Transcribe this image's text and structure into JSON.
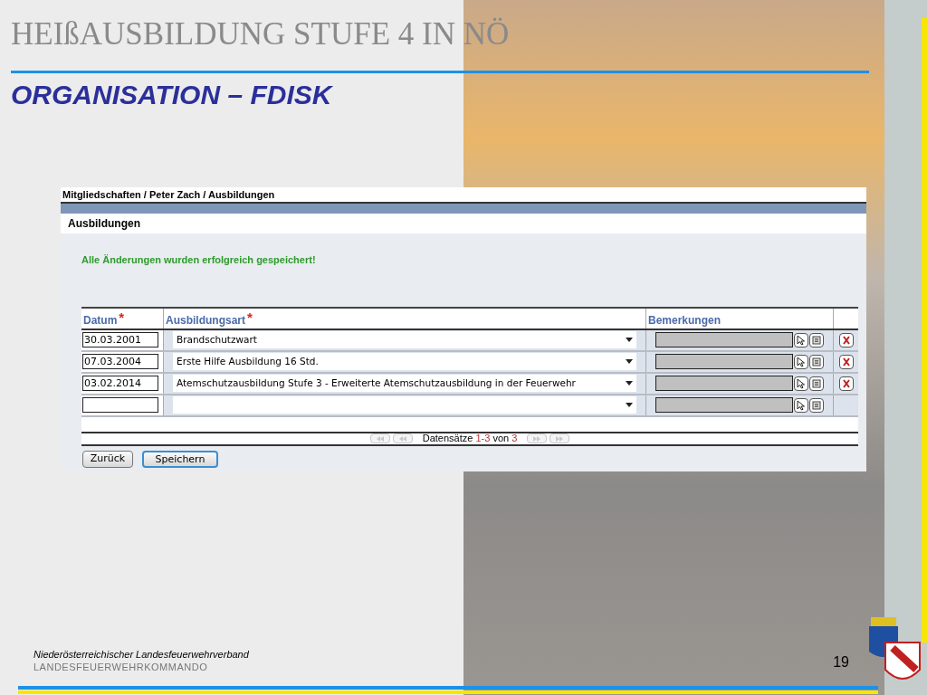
{
  "slide": {
    "title": "HEIßAUSBILDUNG STUFE 4 IN NÖ",
    "subtitle": "ORGANISATION – FDISK"
  },
  "app": {
    "breadcrumb": "Mitgliedschaften / Peter Zach / Ausbildungen",
    "section_title": "Ausbildungen",
    "message": "Alle Änderungen wurden erfolgreich gespeichert!",
    "columns": [
      {
        "label": "Datum",
        "required_mark": "*"
      },
      {
        "label": "Ausbildungsart",
        "required_mark": "*"
      },
      {
        "label": "Bemerkungen"
      }
    ],
    "rows": [
      {
        "date": "30.03.2001",
        "type": "Brandschutzwart",
        "deletable": true
      },
      {
        "date": "07.03.2004",
        "type": "Erste Hilfe Ausbildung 16 Std.",
        "deletable": true
      },
      {
        "date": "03.02.2014",
        "type": "Atemschutzausbildung Stufe 3 - Erweiterte Atemschutzausbildung in der Feuerwehr",
        "deletable": true
      },
      {
        "deletable": false
      }
    ],
    "pagination": {
      "label": "Datensätze",
      "range": "1-3",
      "of": "von",
      "total": "3"
    },
    "buttons": [
      {
        "label": "Zurück",
        "focused": false
      },
      {
        "label": "Speichern",
        "focused": true
      }
    ]
  },
  "footer": {
    "organization": "Niederösterreichischer Landesfeuerwehrverband",
    "command": "LANDESFEUERWEHRKOMMANDO",
    "page": "19"
  }
}
